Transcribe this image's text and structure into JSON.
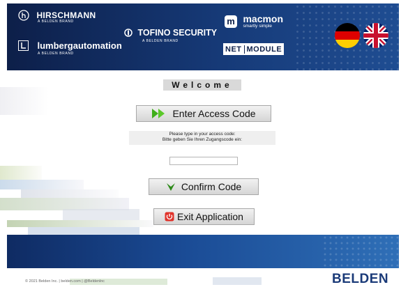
{
  "header": {
    "brands": {
      "hirschmann": {
        "name": "HIRSCHMANN",
        "sub": "A BELDEN BRAND"
      },
      "lumberg": {
        "name": "lumbergautomation",
        "sub": "A BELDEN BRAND"
      },
      "tofino": {
        "name": "TOFINO SECURITY",
        "sub": "A BELDEN BRAND"
      },
      "macmon": {
        "name": "macmon",
        "sub": "smartly simple",
        "mark": "m"
      },
      "netmodule": {
        "left": "NET",
        "right": "MODULE"
      }
    },
    "languages": [
      "german-flag",
      "uk-flag"
    ]
  },
  "main": {
    "welcome": "Welcome",
    "access_button": "Enter Access Code",
    "instructions": {
      "en": "Please type in your access code:",
      "de": "Bitte geben Sie Ihren Zugangscode ein:"
    },
    "code_input": {
      "value": "",
      "placeholder": ""
    },
    "confirm_button": "Confirm Code",
    "exit_button": "Exit Application"
  },
  "footer": {
    "copyright": "© 2021 Belden Inc. | belden.com | @Beldenlnc",
    "logo": "BELDEN"
  },
  "colors": {
    "header_bg": "#0d1f49",
    "band_bg": "#1a4b95",
    "access_arrow": "#3fae1a",
    "confirm_check": "#2e8b1a",
    "exit_icon": "#e0332b",
    "belden_logo": "#1a3a78"
  },
  "icons": {
    "access": "double-arrow-right-icon",
    "confirm": "check-arrow-down-icon",
    "exit": "power-icon"
  }
}
